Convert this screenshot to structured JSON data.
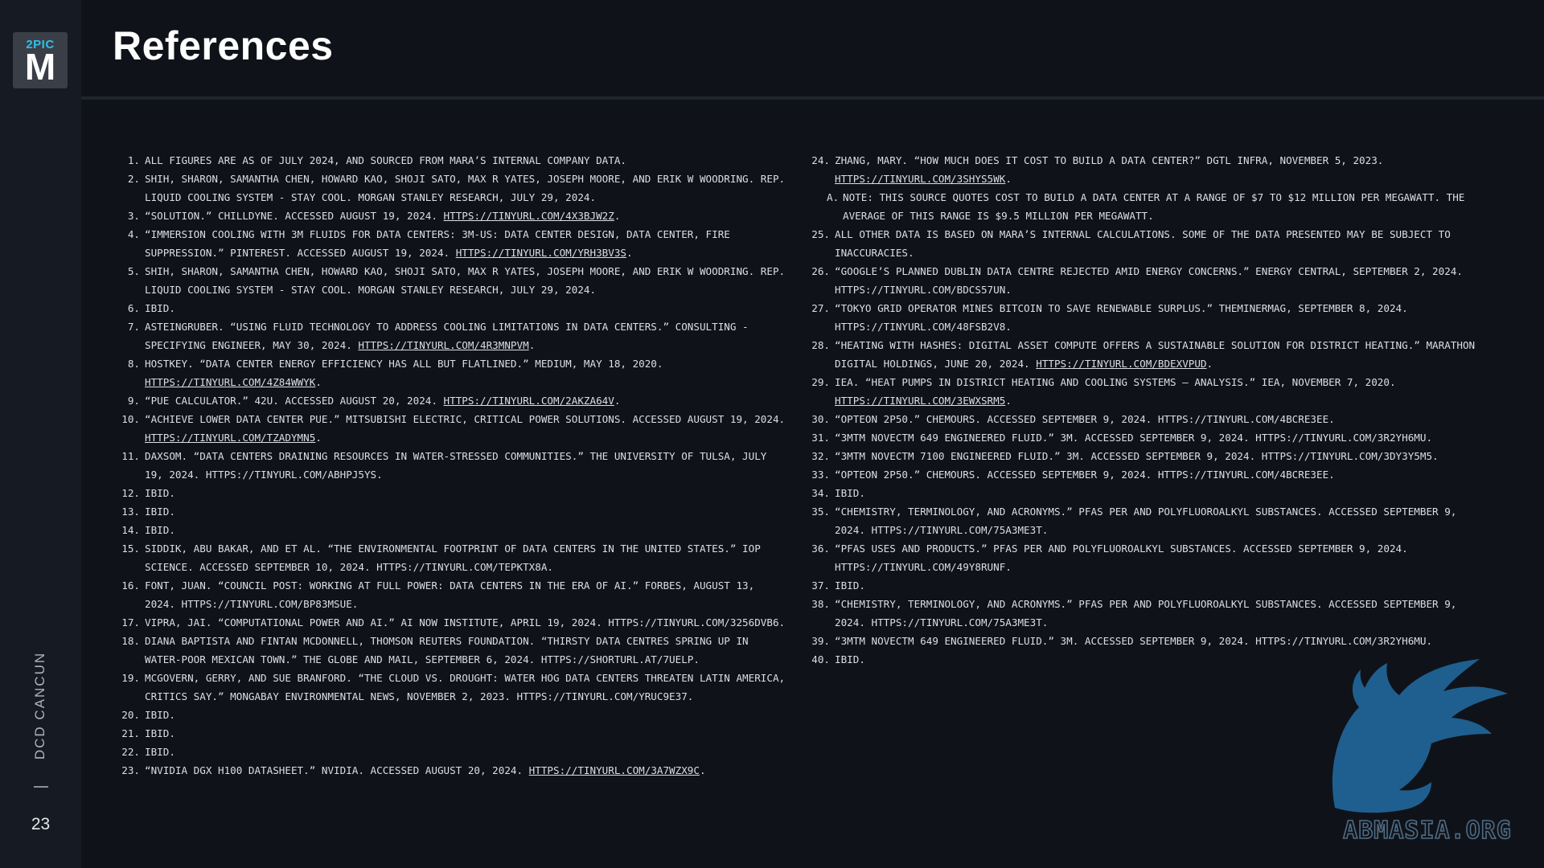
{
  "logo": {
    "top": "2PIC",
    "letter": "M"
  },
  "sidebar": {
    "event": "DCD CANCUN",
    "page_number": "23"
  },
  "header": {
    "title": "References"
  },
  "watermark": {
    "text": "ABMASIA.ORG",
    "color": "#1f5f8f"
  },
  "references_left": [
    {
      "num": "1.",
      "parts": [
        {
          "t": "All figures are as of July 2024, and sourced from MARA’s internal company data."
        }
      ]
    },
    {
      "num": "2.",
      "parts": [
        {
          "t": "Shih, Sharon, Samantha Chen, Howard Kao, Shoji Sato, Max R Yates, Joseph Moore, and Erik W Woodring. Rep. Liquid Cooling System - Stay Cool. Morgan Stanley Research, July 29, 2024."
        }
      ]
    },
    {
      "num": "3.",
      "parts": [
        {
          "t": "“Solution.” Chilldyne. Accessed August 19, 2024. "
        },
        {
          "t": "https://tinyurl.com/4x3bjw2z",
          "link": true
        },
        {
          "t": "."
        }
      ]
    },
    {
      "num": "4.",
      "parts": [
        {
          "t": "“Immersion Cooling with 3M Fluids for Data Centers: 3M-US: Data Center Design, Data Center, Fire Suppression.” Pinterest. Accessed August 19, 2024. "
        },
        {
          "t": "https://tinyurl.com/yrh3bv3s",
          "link": true
        },
        {
          "t": "."
        }
      ]
    },
    {
      "num": "5.",
      "parts": [
        {
          "t": "Shih, Sharon, Samantha Chen, Howard Kao, Shoji Sato, Max R Yates, Joseph Moore, and Erik W Woodring. Rep. Liquid Cooling System - Stay Cool. Morgan Stanley Research, July 29, 2024."
        }
      ]
    },
    {
      "num": "6.",
      "parts": [
        {
          "t": "Ibid."
        }
      ]
    },
    {
      "num": "7.",
      "parts": [
        {
          "t": "asteingruber. “Using Fluid Technology to Address Cooling Limitations in Data Centers.” Consulting - Specifying Engineer, May 30, 2024. "
        },
        {
          "t": "https://tinyurl.com/4r3mnpvm",
          "link": true
        },
        {
          "t": "."
        }
      ]
    },
    {
      "num": "8.",
      "parts": [
        {
          "t": "Hostkey. “Data Center Energy Efficiency Has All but Flatlined.” Medium, May 18, 2020. "
        },
        {
          "t": "https://tinyurl.com/4z84wwyk",
          "link": true
        },
        {
          "t": "."
        }
      ]
    },
    {
      "num": "9.",
      "parts": [
        {
          "t": "“PUE Calculator.” 42U. Accessed August 20, 2024. "
        },
        {
          "t": "https://tinyurl.com/2akza64v",
          "link": true
        },
        {
          "t": "."
        }
      ]
    },
    {
      "num": "10.",
      "parts": [
        {
          "t": "“Achieve Lower Data Center PUE.” Mitsubishi Electric, Critical Power Solutions. Accessed August 19, 2024. "
        },
        {
          "t": "https://tinyurl.com/tzadymn5",
          "link": true
        },
        {
          "t": "."
        }
      ]
    },
    {
      "num": "11.",
      "parts": [
        {
          "t": "Daxsom. “Data Centers Draining Resources in Water-Stressed Communities.” The University of Tulsa, July 19, 2024. https://tinyurl.com/abhpj5ys."
        }
      ]
    },
    {
      "num": "12.",
      "parts": [
        {
          "t": "Ibid."
        }
      ]
    },
    {
      "num": "13.",
      "parts": [
        {
          "t": "Ibid."
        }
      ]
    },
    {
      "num": "14.",
      "parts": [
        {
          "t": "Ibid."
        }
      ]
    },
    {
      "num": "15.",
      "parts": [
        {
          "t": "Siddik, Abu  Bakar, and et al. “The Environmental Footprint of Data Centers in the United States.” IOP Science. Accessed September 10, 2024. https://tinyurl.com/tepktx8a."
        }
      ]
    },
    {
      "num": "16.",
      "parts": [
        {
          "t": "Font, Juan. “Council Post: Working at Full Power: Data Centers in the Era of AI.” Forbes, August 13, 2024. https://tinyurl.com/bp83msue."
        }
      ]
    },
    {
      "num": "17.",
      "parts": [
        {
          "t": "Vipra, Jai. “Computational Power and AI.” AI Now Institute, April 19, 2024. https://tinyurl.com/3256dvb6."
        }
      ]
    },
    {
      "num": "18.",
      "parts": [
        {
          "t": "Diana Baptista and Fintan McDonnell, Thomson Reuters Foundation. “Thirsty Data Centres Spring up in Water-Poor Mexican Town.” The Globe and Mail, September 6, 2024. https://shorturl.at/7uelp."
        }
      ]
    },
    {
      "num": "19.",
      "parts": [
        {
          "t": "McGovern, Gerry, and Sue Branford. “The Cloud vs. Drought: Water Hog Data Centers Threaten Latin America, Critics Say.” Mongabay Environmental News, November 2, 2023. https://tinyurl.com/yruc9e37."
        }
      ]
    },
    {
      "num": "20.",
      "parts": [
        {
          "t": "Ibid."
        }
      ]
    },
    {
      "num": "21.",
      "parts": [
        {
          "t": "Ibid."
        }
      ]
    },
    {
      "num": "22.",
      "parts": [
        {
          "t": "Ibid."
        }
      ]
    },
    {
      "num": "23.",
      "parts": [
        {
          "t": "“NVIDIA DGX H100 Datasheet.” NVIDIA. Accessed August 20, 2024. "
        },
        {
          "t": "https://tinyurl.com/3a7wzx9c",
          "link": true
        },
        {
          "t": "."
        }
      ]
    }
  ],
  "references_right": [
    {
      "num": "24.",
      "parts": [
        {
          "t": "Zhang, Mary. “How Much Does It Cost to Build a Data Center?” Dgtl Infra, November 5, 2023. "
        },
        {
          "t": "https://tinyurl.com/3shys5wk",
          "link": true
        },
        {
          "t": "."
        }
      ]
    },
    {
      "num": "a.",
      "sub": true,
      "parts": [
        {
          "t": "Note: This source quotes cost to build a data center at a range of $7 to $12 million per megawatt. The average of this range is $9.5 million per megawatt."
        }
      ]
    },
    {
      "num": "25.",
      "parts": [
        {
          "t": "All other data is based on MARA’s internal calculations. Some of the data presented may be subject to inaccuracies."
        }
      ]
    },
    {
      "num": "26.",
      "parts": [
        {
          "t": "“Google’s Planned Dublin Data Centre Rejected amid Energy Concerns.” Energy Central, September 2, 2024. https://tinyurl.com/bdcs57un."
        }
      ]
    },
    {
      "num": "27.",
      "parts": [
        {
          "t": "“Tokyo Grid Operator Mines Bitcoin to Save Renewable Surplus.” TheMinerMag, September 8, 2024. https://tinyurl.com/48fsb2v8."
        }
      ]
    },
    {
      "num": "28.",
      "parts": [
        {
          "t": "“Heating with Hashes: Digital Asset Compute Offers a Sustainable Solution for District Heating.” Marathon Digital Holdings, June 20, 2024. "
        },
        {
          "t": "https://tinyurl.com/bdexvpud",
          "link": true
        },
        {
          "t": "."
        }
      ]
    },
    {
      "num": "29.",
      "parts": [
        {
          "t": "IEA. “Heat Pumps in District Heating and Cooling Systems – Analysis.” IEA, November 7, 2020. "
        },
        {
          "t": "https://tinyurl.com/3ewxsrm5",
          "link": true
        },
        {
          "t": "."
        }
      ]
    },
    {
      "num": "30.",
      "parts": [
        {
          "t": "“Opteon 2P50.” Chemours. Accessed September 9, 2024. https://tinyurl.com/4bcre3ee."
        }
      ]
    },
    {
      "num": "31.",
      "parts": [
        {
          "t": "“3MTM NovecTM 649 Engineered Fluid.” 3M. Accessed September 9, 2024. https://tinyurl.com/3r2yh6mu."
        }
      ]
    },
    {
      "num": "32.",
      "parts": [
        {
          "t": "“3MTM NovecTM 7100 Engineered Fluid.” 3M. Accessed September 9, 2024. https://tinyurl.com/3dy3y5m5."
        }
      ]
    },
    {
      "num": "33.",
      "parts": [
        {
          "t": "“Opteon 2P50.” Chemours. Accessed September 9, 2024. https://tinyurl.com/4bcre3ee."
        }
      ]
    },
    {
      "num": "34.",
      "parts": [
        {
          "t": "Ibid."
        }
      ]
    },
    {
      "num": "35.",
      "parts": [
        {
          "t": "“Chemistry, Terminology, and Acronyms.” PFAS per and Polyfluoroalkyl Substances. Accessed September 9, 2024. https://tinyurl.com/75a3me3t."
        }
      ]
    },
    {
      "num": "36.",
      "parts": [
        {
          "t": "“PFAS Uses and Products.” PFAS per and Polyfluoroalkyl Substances. Accessed September 9, 2024. https://tinyurl.com/49y8runf."
        }
      ]
    },
    {
      "num": "37.",
      "parts": [
        {
          "t": "Ibid."
        }
      ]
    },
    {
      "num": "38.",
      "parts": [
        {
          "t": "“Chemistry, Terminology, and Acronyms.” PFAS per and Polyfluoroalkyl Substances. Accessed September 9, 2024. https://tinyurl.com/75a3me3t."
        }
      ]
    },
    {
      "num": "39.",
      "parts": [
        {
          "t": "“3MTM NovecTM 649 Engineered Fluid.” 3M. Accessed September 9, 2024. https://tinyurl.com/3r2yh6mu."
        }
      ]
    },
    {
      "num": "40.",
      "parts": [
        {
          "t": "Ibid."
        }
      ]
    }
  ]
}
